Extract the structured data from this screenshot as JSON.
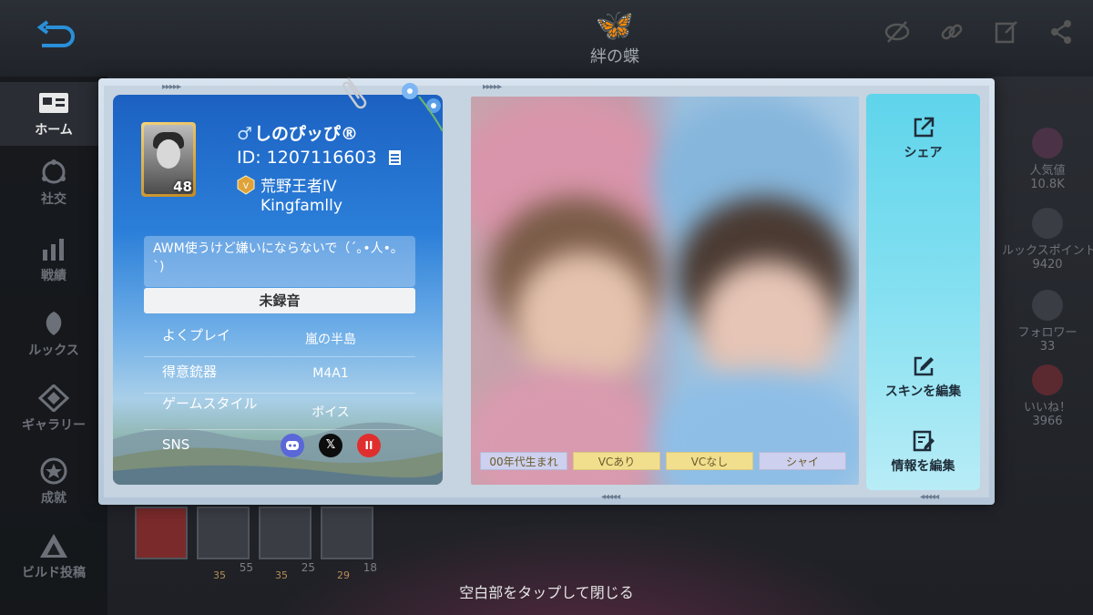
{
  "background": {
    "emblem_text": "絆の蝶",
    "sidebar": [
      {
        "label": "ホーム",
        "icon": "home-card-icon",
        "active": true
      },
      {
        "label": "社交",
        "icon": "social-icon",
        "active": false
      },
      {
        "label": "戦績",
        "icon": "stats-icon",
        "active": false
      },
      {
        "label": "ルックス",
        "icon": "looks-icon",
        "active": false
      },
      {
        "label": "ギャラリー",
        "icon": "gallery-icon",
        "active": false
      },
      {
        "label": "成就",
        "icon": "achievement-icon",
        "active": false
      },
      {
        "label": "ビルド投稿",
        "icon": "build-post-icon",
        "active": false
      }
    ],
    "stats": [
      {
        "label": "人気値",
        "value": "10.8K"
      },
      {
        "label": "ルックスポイント",
        "value": "9420"
      },
      {
        "label": "フォロワー",
        "value": "33"
      },
      {
        "label": "いいね！",
        "value": "3966"
      }
    ],
    "thumb_numbers": [
      "",
      "55",
      "25",
      "18"
    ],
    "thumb_levels": [
      "",
      "35",
      "35",
      "29"
    ]
  },
  "profile": {
    "gender_symbol": "♂",
    "name": "しのぴッぴ®",
    "id": "ID: 1207116603",
    "rank": "荒野王者Ⅳ",
    "clan": "Kingfamlly",
    "avatar_level": "48",
    "bio": "AWM使うけど嫌いにならないで（´｡•人•｡`)",
    "voice_button": "未録音",
    "info": [
      {
        "key": "よくプレイ",
        "value": "嵐の半島"
      },
      {
        "key": "得意銃器",
        "value": "M4A1"
      },
      {
        "key": "ゲームスタイル",
        "value": "ボイス"
      },
      {
        "key": "SNS",
        "value": ""
      }
    ],
    "sns_x": "𝕏",
    "sns_other": "II"
  },
  "tags": [
    {
      "label": "00年代生まれ",
      "color": "#cdd0ee"
    },
    {
      "label": "VCあり",
      "color": "#f1df8e"
    },
    {
      "label": "VCなし",
      "color": "#f1df8e"
    },
    {
      "label": "シャイ",
      "color": "#cdd0ee"
    }
  ],
  "actions": {
    "share": "シェア",
    "edit_skin": "スキンを編集",
    "edit_info": "情報を編集"
  },
  "close_hint": "空白部をタップして閉じる"
}
